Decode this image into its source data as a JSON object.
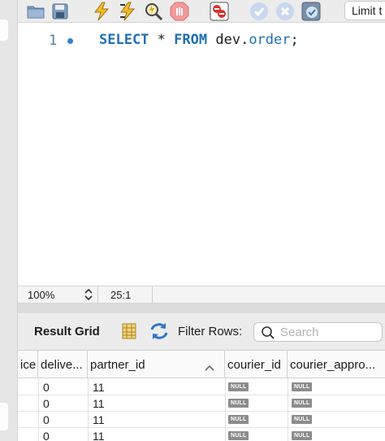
{
  "toolbar": {
    "icons": [
      "folder-icon",
      "save-icon",
      "execute-icon",
      "execute-current-icon",
      "explain-icon",
      "stop-icon",
      "toggle-error-icon",
      "commit-icon",
      "rollback-icon",
      "autocommit-icon"
    ],
    "limit_label": "Limit t"
  },
  "editor": {
    "line_number": "1",
    "code": {
      "kw_select": "SELECT",
      "star": " * ",
      "kw_from": "FROM",
      "space": " ",
      "schema": "dev",
      "dot": ".",
      "table": "order",
      "semicolon": ";"
    }
  },
  "statusbar": {
    "zoom": "100%",
    "cursor": "25:1"
  },
  "result": {
    "title": "Result Grid",
    "filter_label": "Filter Rows:",
    "search_placeholder": "Search"
  },
  "grid": {
    "columns": [
      "ice",
      "delive...",
      "partner_id",
      "courier_id",
      "courier_appro..."
    ],
    "null_label": "NULL",
    "rows": [
      {
        "delivery": "0",
        "partner_id": "11"
      },
      {
        "delivery": "0",
        "partner_id": "11"
      },
      {
        "delivery": "0",
        "partner_id": "11"
      },
      {
        "delivery": "0",
        "partner_id": "11"
      }
    ]
  },
  "colors": {
    "keyword": "#1f6fb5",
    "line_dot": "#2f80d1",
    "null_badge": "#8c8c8c"
  }
}
